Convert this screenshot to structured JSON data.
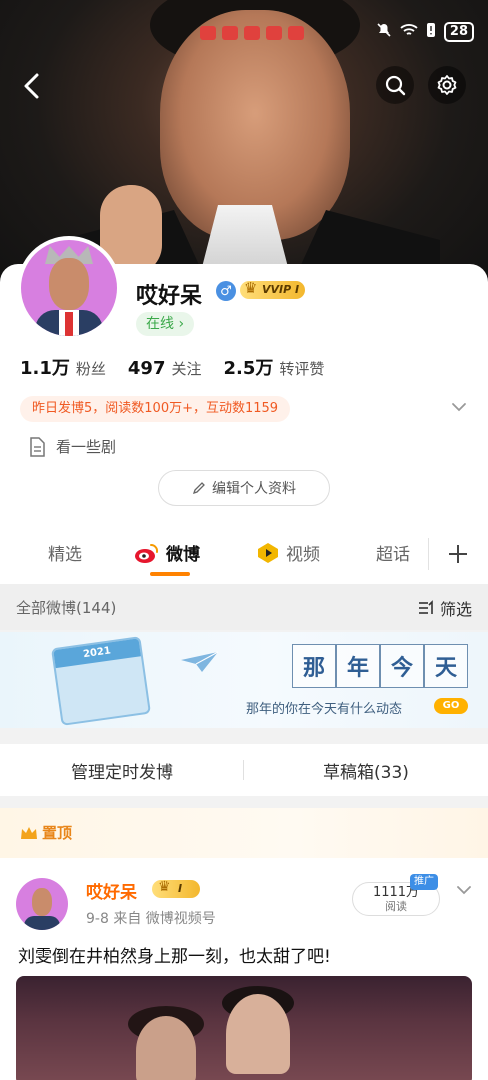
{
  "status_bar": {
    "battery": "28"
  },
  "profile": {
    "name": "哎好呆",
    "gender_symbol": "♂",
    "vip_label": "VVIP I",
    "online_label": "在线 ›",
    "stats": [
      {
        "value": "1.1万",
        "label": "粉丝"
      },
      {
        "value": "497",
        "label": "关注"
      },
      {
        "value": "2.5万",
        "label": "转评赞"
      }
    ],
    "activity_summary": "昨日发博5，阅读数100万+，互动数1159",
    "bio": "看一些剧",
    "edit_button": "编辑个人资料"
  },
  "tabs": [
    {
      "label": "精选",
      "active": false
    },
    {
      "label": "微博",
      "active": true
    },
    {
      "label": "视频",
      "active": false
    },
    {
      "label": "超话",
      "active": false
    }
  ],
  "feed_header": {
    "count_label": "全部微博(144)",
    "filter_label": "筛选"
  },
  "banner": {
    "calendar_year": "2021",
    "title_chars": [
      "那",
      "年",
      "今",
      "天"
    ],
    "subtitle": "那年的你在今天有什么动态",
    "go_label": "GO"
  },
  "manage": {
    "scheduled_label": "管理定时发博",
    "drafts_label": "草稿箱(33)"
  },
  "pinned_post": {
    "pin_label": "置顶",
    "author": "哎好呆",
    "badge": "I",
    "meta": "9-8  来自 微博视频号",
    "views_value": "1111万",
    "views_label": "阅读",
    "promo_label": "推广",
    "text": "刘雯倒在井柏然身上那一刻，也太甜了吧!"
  },
  "colors": {
    "accent": "#ff8200",
    "tag_text": "#f05a23",
    "online_green": "#3ba94a",
    "name_orange": "#ff6a00"
  }
}
